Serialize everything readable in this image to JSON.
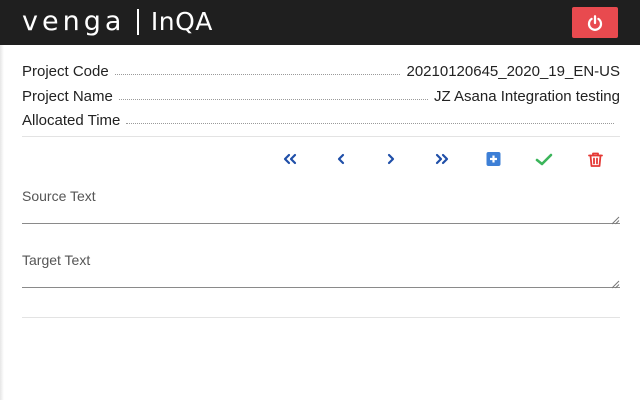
{
  "header": {
    "brand": "venga",
    "product": "InQA",
    "logout_icon": "power-icon",
    "colors": {
      "bar": "#1f1f1f",
      "logout": "#e84a4f"
    }
  },
  "project": {
    "code_label": "Project Code",
    "code_value": "20210120645_2020_19_EN-US",
    "name_label": "Project Name",
    "name_value": "JZ Asana Integration testing",
    "time_label": "Allocated Time",
    "time_value": ""
  },
  "toolbar": {
    "buttons": [
      {
        "name": "first",
        "icon": "double-chevron-left-icon",
        "color": "#1f4fa8"
      },
      {
        "name": "previous",
        "icon": "chevron-left-icon",
        "color": "#1f4fa8"
      },
      {
        "name": "next",
        "icon": "chevron-right-icon",
        "color": "#1f4fa8"
      },
      {
        "name": "last",
        "icon": "double-chevron-right-icon",
        "color": "#1f4fa8"
      },
      {
        "name": "add",
        "icon": "plus-square-icon",
        "color": "#3d7fd6"
      },
      {
        "name": "confirm",
        "icon": "check-icon",
        "color": "#3bb55b"
      },
      {
        "name": "delete",
        "icon": "trash-icon",
        "color": "#e53935"
      }
    ]
  },
  "fields": {
    "source_label": "Source Text",
    "source_value": "",
    "target_label": "Target Text",
    "target_value": ""
  }
}
